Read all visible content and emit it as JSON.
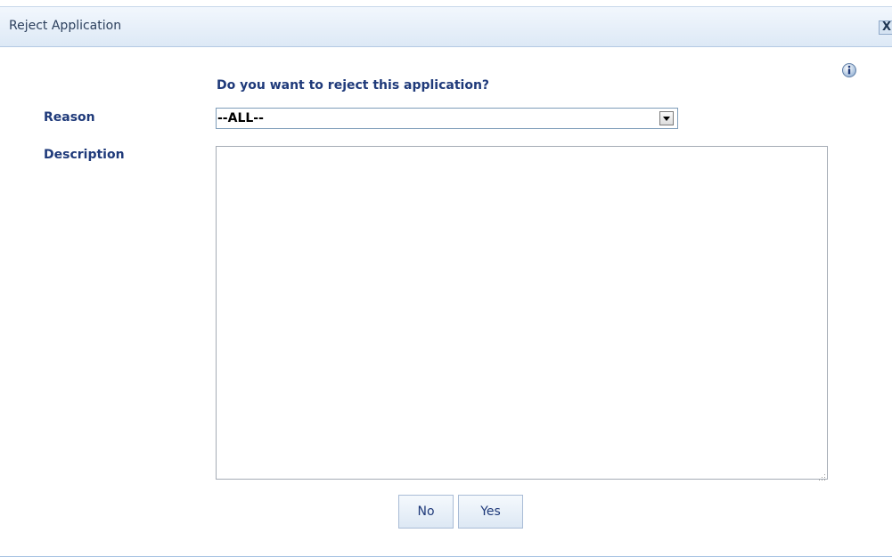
{
  "dialog": {
    "title": "Reject Application",
    "close_label": "X",
    "info_icon": "info-icon",
    "prompt": "Do you want to reject this application?",
    "reason_label": "Reason",
    "reason_selected": "--ALL--",
    "description_label": "Description",
    "description_value": "",
    "no_label": "No",
    "yes_label": "Yes"
  },
  "colors": {
    "label": "#1f3a7a",
    "titlebar_top": "#f2f7fd",
    "titlebar_bottom": "#dde9f6",
    "button_border": "#a9bcd6"
  }
}
